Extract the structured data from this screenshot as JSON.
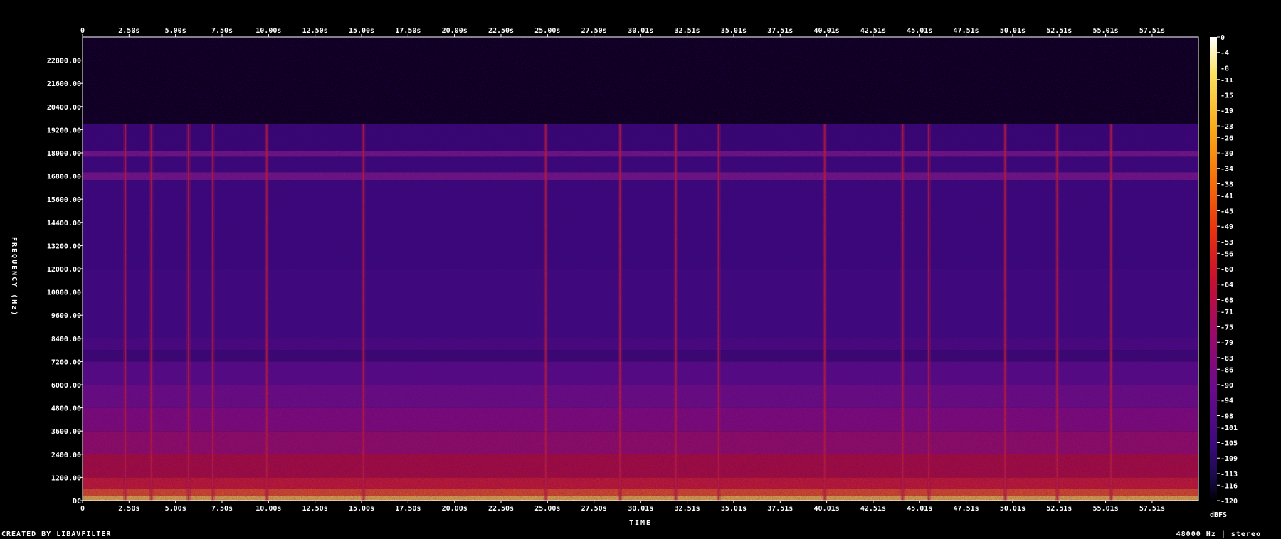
{
  "footer": {
    "credit": "CREATED BY LIBAVFILTER",
    "stream_info": "48000 Hz | stereo"
  },
  "chart_data": {
    "type": "heatmap",
    "title": "",
    "xlabel": "TIME",
    "ylabel": "FREQUENCY (Hz)",
    "colorbar_label": "dBFS",
    "x_ticks": [
      "0",
      "2.50s",
      "5.00s",
      "7.50s",
      "10.00s",
      "12.50s",
      "15.00s",
      "17.50s",
      "20.00s",
      "22.50s",
      "25.00s",
      "27.50s",
      "30.01s",
      "32.51s",
      "35.01s",
      "37.51s",
      "40.01s",
      "42.51s",
      "45.01s",
      "47.51s",
      "50.01s",
      "52.51s",
      "55.01s",
      "57.51s"
    ],
    "x_tick_values": [
      0,
      2.5,
      5.0,
      7.5,
      10.0,
      12.5,
      15.0,
      17.5,
      20.0,
      22.5,
      25.0,
      27.5,
      30.01,
      32.51,
      35.01,
      37.51,
      40.01,
      42.51,
      45.01,
      47.51,
      50.01,
      52.51,
      55.01,
      57.51
    ],
    "xlim": [
      0,
      60
    ],
    "y_ticks": [
      "DC",
      "1200.00",
      "2400.00",
      "3600.00",
      "4800.00",
      "6000.00",
      "7200.00",
      "8400.00",
      "9600.00",
      "10800.00",
      "12000.00",
      "13200.00",
      "14400.00",
      "15600.00",
      "16800.00",
      "18000.00",
      "19200.00",
      "20400.00",
      "21600.00",
      "22800.00"
    ],
    "y_tick_values": [
      0,
      1200,
      2400,
      3600,
      4800,
      6000,
      7200,
      8400,
      9600,
      10800,
      12000,
      13200,
      14400,
      15600,
      16800,
      18000,
      19200,
      20400,
      21600,
      22800
    ],
    "ylim": [
      0,
      24000
    ],
    "colorbar_ticks": [
      "0",
      "-4",
      "-8",
      "-11",
      "-15",
      "-19",
      "-23",
      "-26",
      "-30",
      "-34",
      "-38",
      "-41",
      "-45",
      "-49",
      "-53",
      "-56",
      "-60",
      "-64",
      "-68",
      "-71",
      "-75",
      "-79",
      "-83",
      "-86",
      "-90",
      "-94",
      "-98",
      "-101",
      "-105",
      "-109",
      "-113",
      "-116",
      "-120"
    ],
    "colorbar_values": [
      0,
      -4,
      -8,
      -11,
      -15,
      -19,
      -23,
      -26,
      -30,
      -34,
      -38,
      -41,
      -45,
      -49,
      -53,
      -56,
      -60,
      -64,
      -68,
      -71,
      -75,
      -79,
      -83,
      -86,
      -90,
      -94,
      -98,
      -101,
      -105,
      -109,
      -113,
      -116,
      -120
    ],
    "colorbar_range": [
      -120,
      0
    ],
    "colormap": [
      "#000000",
      "#1a0a4a",
      "#3b0a7a",
      "#6a0a8c",
      "#9a0a6a",
      "#c8102e",
      "#e83010",
      "#f46a08",
      "#f8a818",
      "#fce060",
      "#ffffff"
    ],
    "frequency_cutoff_hz": 19500,
    "transients_s": [
      2.3,
      3.7,
      5.7,
      7.0,
      9.9,
      15.1,
      24.9,
      28.9,
      31.9,
      34.2,
      39.9,
      44.1,
      45.5,
      49.6,
      52.4,
      55.3
    ]
  }
}
